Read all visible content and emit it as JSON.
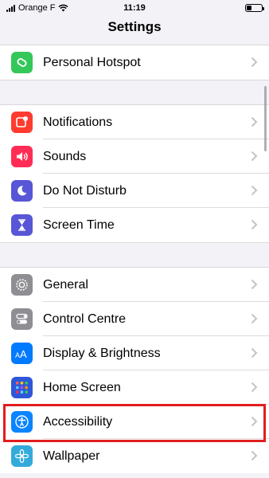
{
  "status": {
    "carrier": "Orange F",
    "time": "11:19"
  },
  "nav": {
    "title": "Settings"
  },
  "groups": [
    {
      "items": [
        {
          "label": "Personal Hotspot",
          "icon": "personal-hotspot-icon",
          "color": "#34c759"
        }
      ]
    },
    {
      "items": [
        {
          "label": "Notifications",
          "icon": "notifications-icon",
          "color": "#ff3b30"
        },
        {
          "label": "Sounds",
          "icon": "sounds-icon",
          "color": "#ff2d55"
        },
        {
          "label": "Do Not Disturb",
          "icon": "do-not-disturb-icon",
          "color": "#5856d6"
        },
        {
          "label": "Screen Time",
          "icon": "screen-time-icon",
          "color": "#5856d6"
        }
      ]
    },
    {
      "items": [
        {
          "label": "General",
          "icon": "general-gear-icon",
          "color": "#8e8e93"
        },
        {
          "label": "Control Centre",
          "icon": "control-centre-icon",
          "color": "#8e8e93"
        },
        {
          "label": "Display & Brightness",
          "icon": "display-brightness-icon",
          "color": "#007aff"
        },
        {
          "label": "Home Screen",
          "icon": "home-screen-icon",
          "color": "#2f57d9"
        },
        {
          "label": "Accessibility",
          "icon": "accessibility-icon",
          "color": "#0a84ff"
        },
        {
          "label": "Wallpaper",
          "icon": "wallpaper-icon",
          "color": "#34aadc"
        }
      ]
    }
  ],
  "highlight_color": "#e21d1d"
}
